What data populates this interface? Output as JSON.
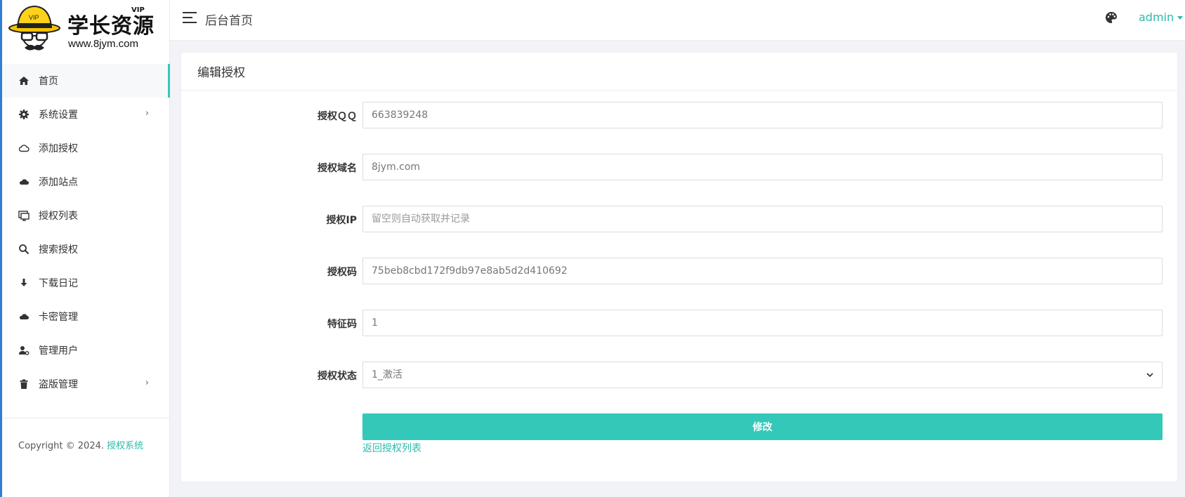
{
  "brand": {
    "name": "学长资源",
    "url": "www.8jym.com",
    "vip_badge": "VIP",
    "hat_badge": "VIP"
  },
  "sidebar": {
    "items": [
      {
        "label": "首页",
        "icon": "home-icon",
        "has_arrow": false
      },
      {
        "label": "系统设置",
        "icon": "gear-icon",
        "has_arrow": true
      },
      {
        "label": "添加授权",
        "icon": "cloud-outline-icon",
        "has_arrow": false
      },
      {
        "label": "添加站点",
        "icon": "cloud-icon",
        "has_arrow": false
      },
      {
        "label": "授权列表",
        "icon": "monitor-icon",
        "has_arrow": false
      },
      {
        "label": "搜索授权",
        "icon": "search-icon",
        "has_arrow": false
      },
      {
        "label": "下载日记",
        "icon": "download-icon",
        "has_arrow": false
      },
      {
        "label": "卡密管理",
        "icon": "cloud-icon",
        "has_arrow": false
      },
      {
        "label": "管理用户",
        "icon": "user-gear-icon",
        "has_arrow": false
      },
      {
        "label": "盗版管理",
        "icon": "trash-icon",
        "has_arrow": true
      }
    ],
    "arrow": "›",
    "copyright_prefix": "Copyright © 2024.",
    "copyright_link": "授权系统"
  },
  "topbar": {
    "breadcrumb": "后台首页",
    "user": "admin"
  },
  "card": {
    "title": "编辑授权",
    "fields": [
      {
        "label": "授权ＱＱ",
        "value": "663839248",
        "placeholder": ""
      },
      {
        "label": "授权域名",
        "value": "8jym.com",
        "placeholder": ""
      },
      {
        "label": "授权IP",
        "value": "",
        "placeholder": "留空则自动获取并记录"
      },
      {
        "label": "授权码",
        "value": "75beb8cbd172f9db97e8ab5d2d410692",
        "placeholder": ""
      },
      {
        "label": "特征码",
        "value": "1",
        "placeholder": ""
      }
    ],
    "status": {
      "label": "授权状态",
      "selected": "1_激活"
    },
    "submit_label": "修改",
    "back_link": "返回授权列表"
  },
  "colors": {
    "accent": "#34c8b9",
    "link": "#2bbbad",
    "sidebar_border": "#2d7fd3"
  }
}
